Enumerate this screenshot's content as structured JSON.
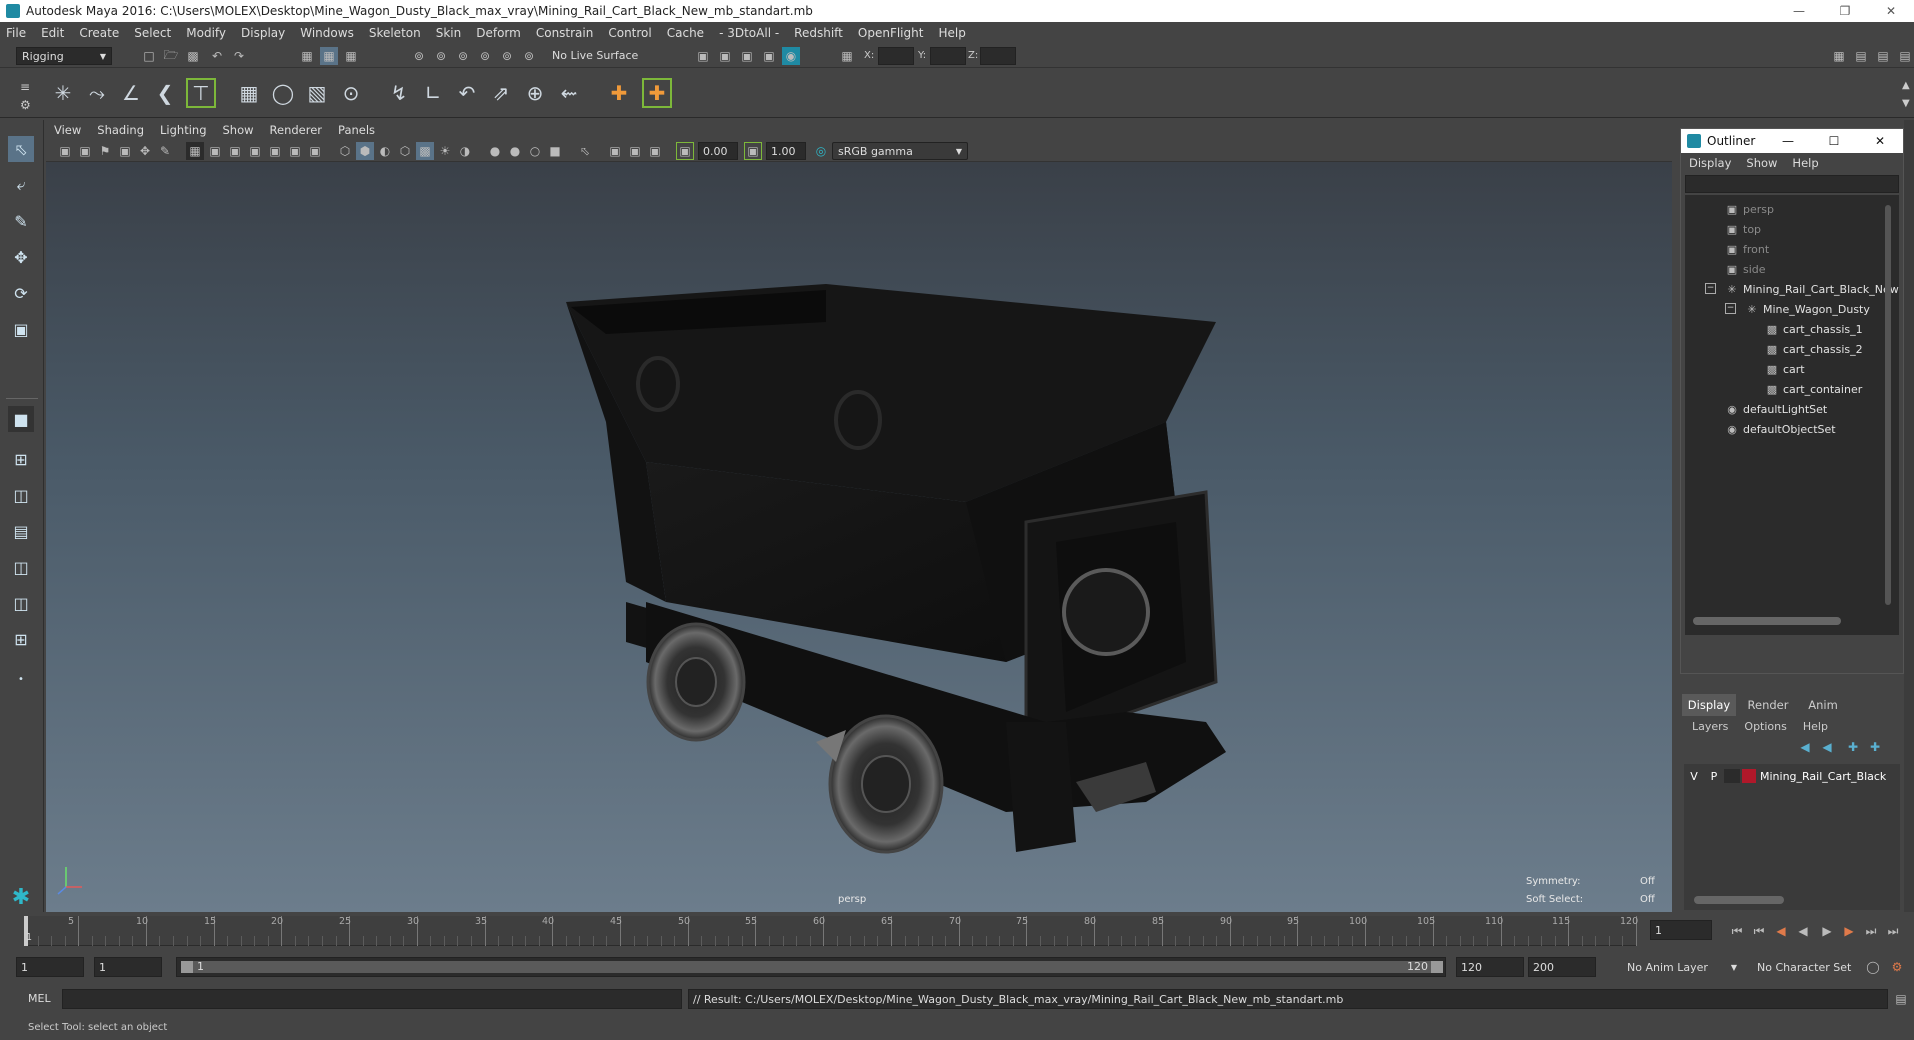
{
  "title": "Autodesk Maya 2016: C:\\Users\\MOLEX\\Desktop\\Mine_Wagon_Dusty_Black_max_vray\\Mining_Rail_Cart_Black_New_mb_standart.mb",
  "menus": [
    "File",
    "Edit",
    "Create",
    "Select",
    "Modify",
    "Display",
    "Windows",
    "Skeleton",
    "Skin",
    "Deform",
    "Constrain",
    "Control",
    "Cache",
    "- 3DtoAll -",
    "Redshift",
    "OpenFlight",
    "Help"
  ],
  "status_line": {
    "mode": "Rigging",
    "live_surface": "No Live Surface",
    "x_label": "X:",
    "y_label": "Y:",
    "z_label": "Z:"
  },
  "panel_menus": [
    "View",
    "Shading",
    "Lighting",
    "Show",
    "Renderer",
    "Panels"
  ],
  "panel_toolbar": {
    "exposure": "0.00",
    "gamma": "1.00",
    "color_space": "sRGB gamma"
  },
  "viewport": {
    "camera_label": "persp",
    "symmetry_label": "Symmetry:",
    "symmetry_value": "Off",
    "soft_select_label": "Soft Select:",
    "soft_select_value": "Off"
  },
  "outliner": {
    "title": "Outliner",
    "menus": [
      "Display",
      "Show",
      "Help"
    ],
    "items": [
      {
        "label": "persp",
        "icon": "camera-icon",
        "depth": 1
      },
      {
        "label": "top",
        "icon": "camera-icon",
        "depth": 1
      },
      {
        "label": "front",
        "icon": "camera-icon",
        "depth": 1
      },
      {
        "label": "side",
        "icon": "camera-icon",
        "depth": 1
      },
      {
        "label": "Mining_Rail_Cart_Black_New",
        "icon": "group-icon",
        "depth": 1
      },
      {
        "label": "Mine_Wagon_Dusty",
        "icon": "group-icon",
        "depth": 2
      },
      {
        "label": "cart_chassis_1",
        "icon": "mesh-icon",
        "depth": 3
      },
      {
        "label": "cart_chassis_2",
        "icon": "mesh-icon",
        "depth": 3
      },
      {
        "label": "cart",
        "icon": "mesh-icon",
        "depth": 3
      },
      {
        "label": "cart_container",
        "icon": "mesh-icon",
        "depth": 3
      },
      {
        "label": "defaultLightSet",
        "icon": "set-icon",
        "depth": 1
      },
      {
        "label": "defaultObjectSet",
        "icon": "set-icon",
        "depth": 1
      }
    ]
  },
  "layer_editor": {
    "tabs": [
      "Display",
      "Render",
      "Anim"
    ],
    "menus": [
      "Layers",
      "Options",
      "Help"
    ],
    "layer": {
      "v": "V",
      "p": "P",
      "name": "Mining_Rail_Cart_Black",
      "color": "#b0182a"
    }
  },
  "timeline": {
    "ticks": [
      5,
      10,
      15,
      20,
      25,
      30,
      35,
      40,
      45,
      50,
      55,
      60,
      65,
      70,
      75,
      80,
      85,
      90,
      95,
      100,
      105,
      110,
      115,
      120
    ],
    "current_marker": "1",
    "current_frame": "1",
    "range_start": "1",
    "playback_start": "1",
    "slider_start": "1",
    "slider_end": "120",
    "playback_end": "120",
    "range_end": "200",
    "anim_layer": "No Anim Layer",
    "character_set": "No Character Set"
  },
  "command_line": {
    "lang": "MEL",
    "result": "// Result: C:/Users/MOLEX/Desktop/Mine_Wagon_Dusty_Black_max_vray/Mining_Rail_Cart_Black_New_mb_standart.mb"
  },
  "help_line": "Select Tool: select an object",
  "colors": {
    "accent": "#1f8aa3",
    "panel": "#444444",
    "field": "#2b2b2b",
    "layer_red": "#b0182a"
  }
}
